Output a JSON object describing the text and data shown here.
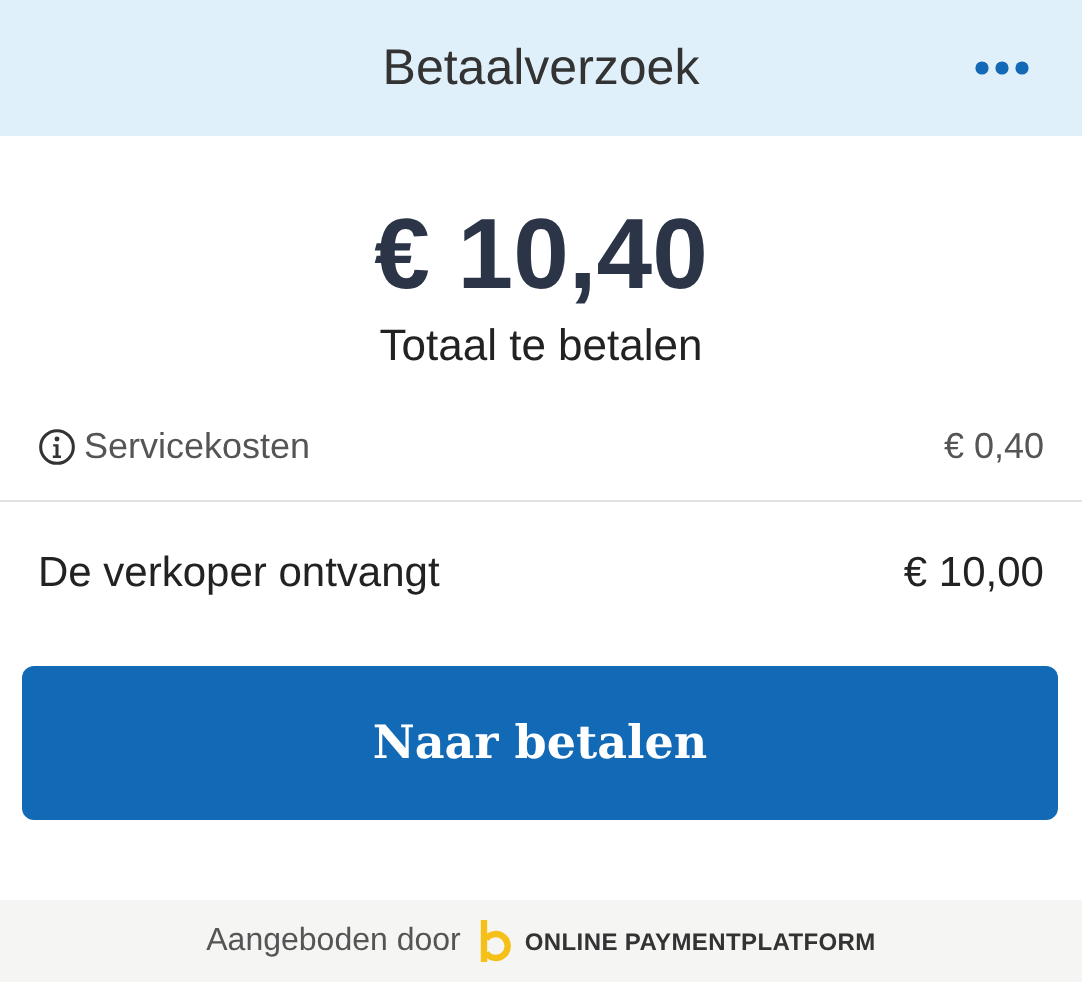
{
  "header": {
    "title": "Betaalverzoek"
  },
  "amount": {
    "value": "€ 10,40",
    "caption": "Totaal te betalen"
  },
  "fees": [
    {
      "label": "Servicekosten",
      "value": "€ 0,40"
    }
  ],
  "seller": {
    "label": "De verkoper ontvangt",
    "value": "€ 10,00"
  },
  "pay_button": {
    "label": "Naar betalen"
  },
  "footer": {
    "text": "Aangeboden door",
    "brand": "ONLINE PAYMENTPLATFORM"
  }
}
